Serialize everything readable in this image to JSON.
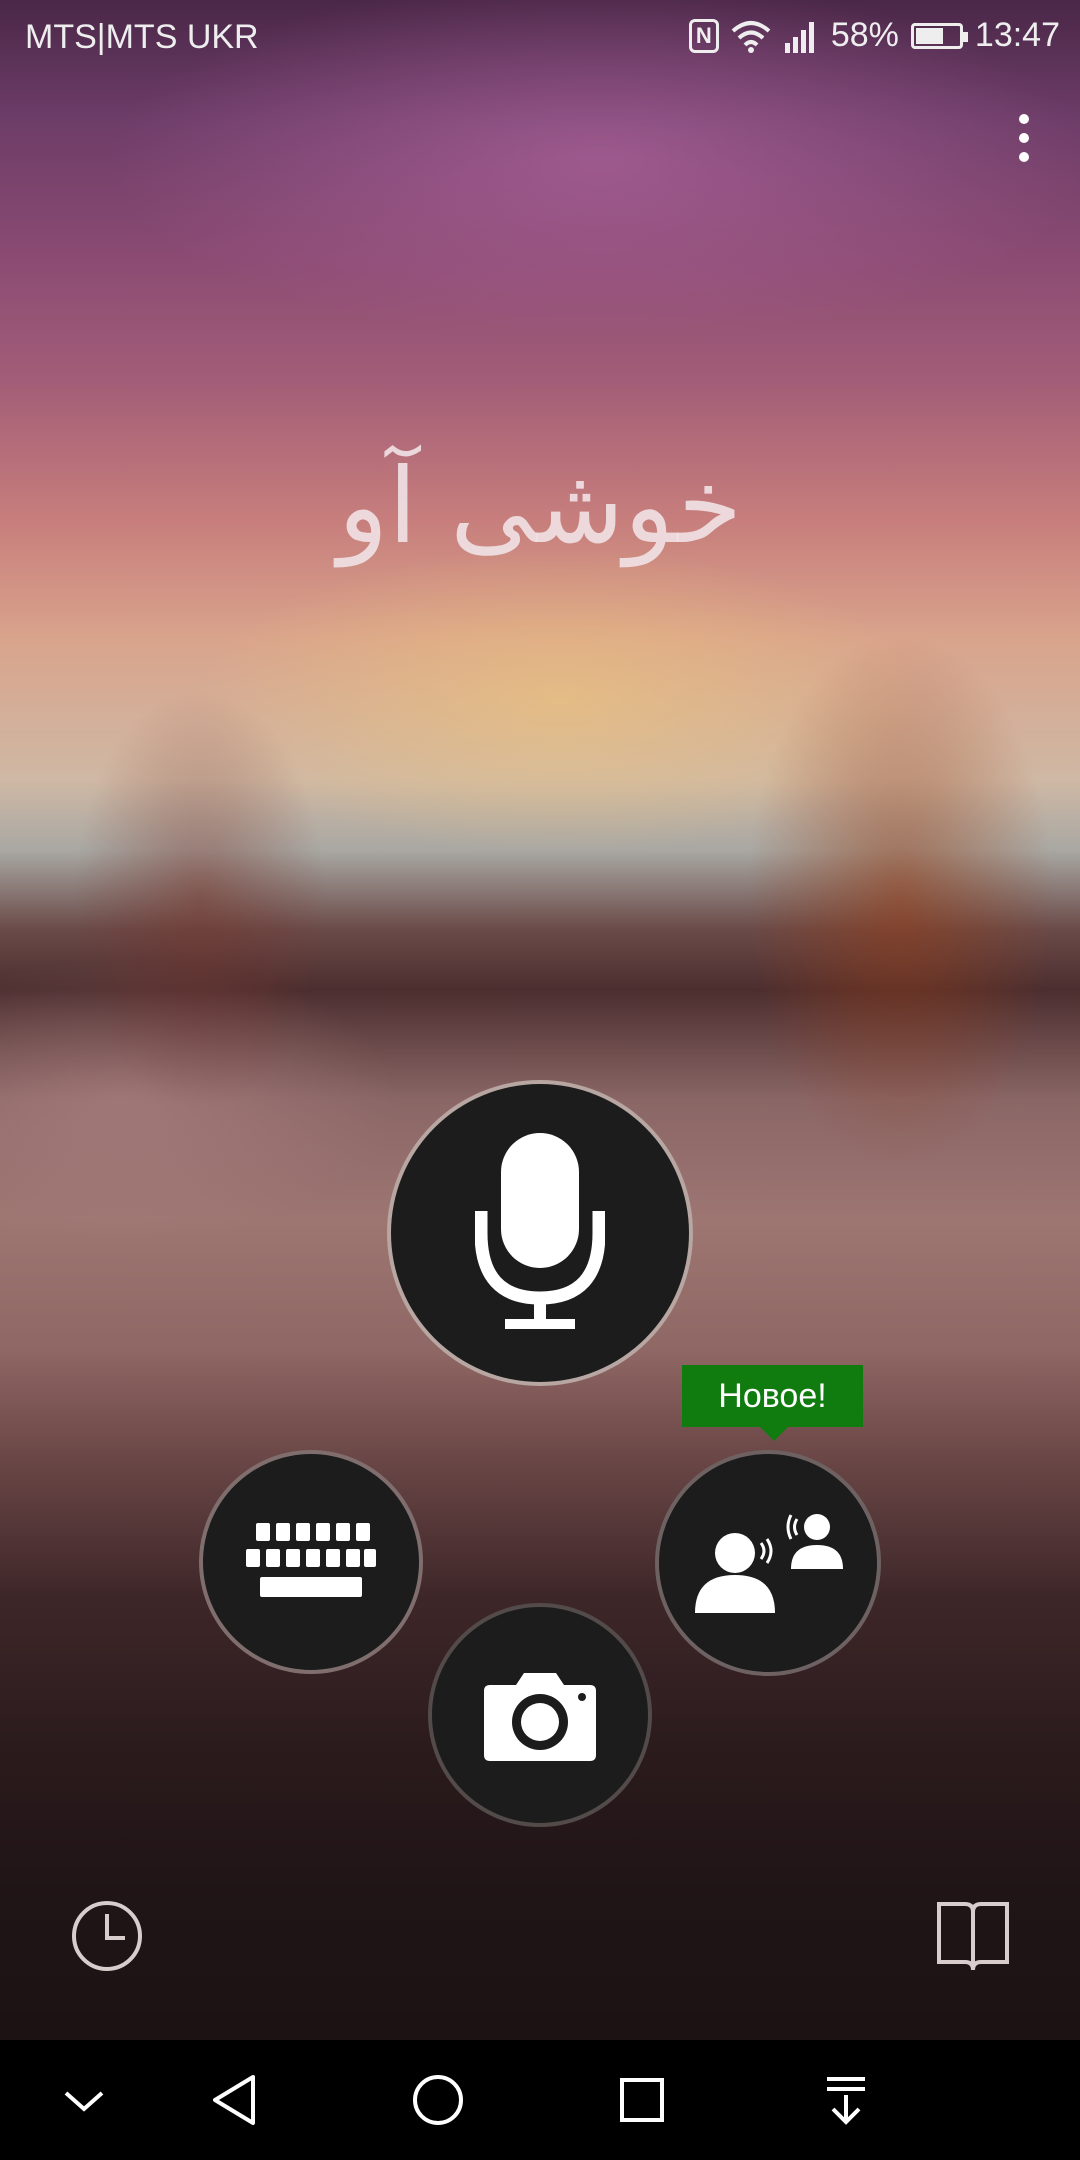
{
  "status_bar": {
    "carrier": "MTS|MTS UKR",
    "battery_percent": "58%",
    "battery_level": 0.58,
    "time": "13:47",
    "icons": [
      "nfc-icon",
      "wifi-icon",
      "signal-icon",
      "battery-icon"
    ]
  },
  "main": {
    "phrase": "خوشی آو",
    "new_badge": "Новое!",
    "buttons": [
      "microphone-icon",
      "keyboard-icon",
      "camera-icon",
      "conversation-icon"
    ]
  },
  "bottom": {
    "icons": [
      "history-icon",
      "phrasebook-icon"
    ]
  },
  "navbar": {
    "icons": [
      "collapse-icon",
      "back-icon",
      "home-icon",
      "recents-icon",
      "notifications-icon"
    ]
  },
  "colors": {
    "badge": "#107c10",
    "button_bg": "#1c1c1c"
  }
}
